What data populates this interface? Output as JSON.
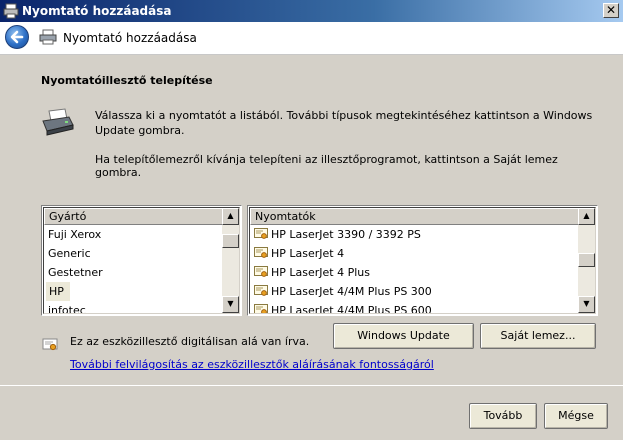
{
  "window": {
    "title": "Nyomtató hozzáadása",
    "close_glyph": "✕"
  },
  "header": {
    "title": "Nyomtató hozzáadása"
  },
  "section": {
    "title": "Nyomtatóillesztő telepítése",
    "paragraph1": "Válassza ki a nyomtatót a listából. További típusok megtekintéséhez kattintson a Windows Update gombra.",
    "paragraph2": "Ha telepítőlemezről kívánja telepíteni az illesztőprogramot, kattintson a Saját lemez gombra."
  },
  "manufacturers": {
    "header": "Gyártó",
    "items": [
      "Fuji Xerox",
      "Generic",
      "Gestetner",
      "HP",
      "infotec"
    ],
    "selected": "HP"
  },
  "printers": {
    "header": "Nyomtatók",
    "items": [
      "HP LaserJet 3390 / 3392 PS",
      "HP LaserJet 4",
      "HP LaserJet 4 Plus",
      "HP LaserJet 4/4M Plus PS 300",
      "HP LaserJet 4/4M Plus PS 600"
    ]
  },
  "buttons": {
    "windows_update": "Windows Update",
    "have_disk": "Saját lemez...",
    "next": "Tovább",
    "cancel": "Mégse"
  },
  "signature": {
    "status": "Ez az eszközillesztő digitálisan alá van írva.",
    "link": "További felvilágosítás az eszközillesztők aláírásának fontosságáról"
  }
}
